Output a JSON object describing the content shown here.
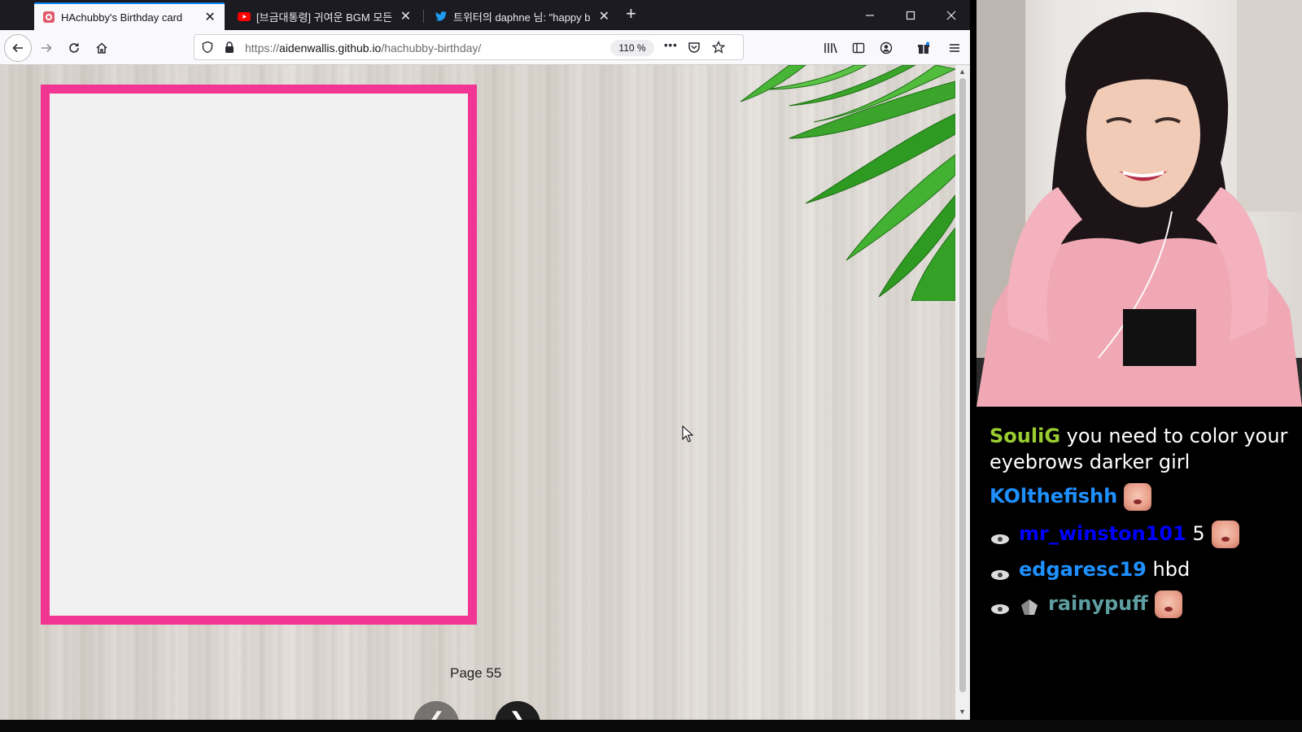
{
  "browser": {
    "tabs": [
      {
        "title": "HAchubby's Birthday card",
        "active": true,
        "favicon": "birthday-card-favicon"
      },
      {
        "title": "[브금대통령] 귀여운 BGM 모든",
        "active": false,
        "favicon": "youtube-favicon"
      },
      {
        "title": "트위터의 daphne 님: \"happy b",
        "active": false,
        "favicon": "twitter-favicon"
      }
    ],
    "new_tab_label": "+",
    "close_glyph": "✕",
    "url_prefix": "https://",
    "url_host": "aidenwallis.github.io",
    "url_path": "/hachubby-birthday/",
    "zoom": "110 %",
    "more_glyph": "•••"
  },
  "page": {
    "page_label": "Page 55",
    "prev_glyph": "❮",
    "next_glyph": "❯"
  },
  "chat": {
    "messages": [
      {
        "user": "SouliG",
        "user_color": "#9acd32",
        "text": "you need to color your eyebrows darker girl",
        "badges": [],
        "emote": false
      },
      {
        "user": "KOlthefishh",
        "user_color": "#1e90ff",
        "text": "",
        "badges": [],
        "emote": true
      },
      {
        "user": "mr_winston101",
        "user_color": "#0000ff",
        "text": "5",
        "badges": [
          "sub-badge"
        ],
        "emote": true
      },
      {
        "user": "edgaresc19",
        "user_color": "#1e90ff",
        "text": "hbd",
        "badges": [
          "sub-badge"
        ],
        "emote": false
      },
      {
        "user": "rainypuff",
        "user_color": "#5f9ea0",
        "text": "",
        "badges": [
          "sub-badge",
          "bits-badge"
        ],
        "emote": true
      }
    ]
  },
  "colors": {
    "card_border": "#f13592",
    "tab_active_accent": "#0a84ff",
    "chat_background": "#000000"
  }
}
